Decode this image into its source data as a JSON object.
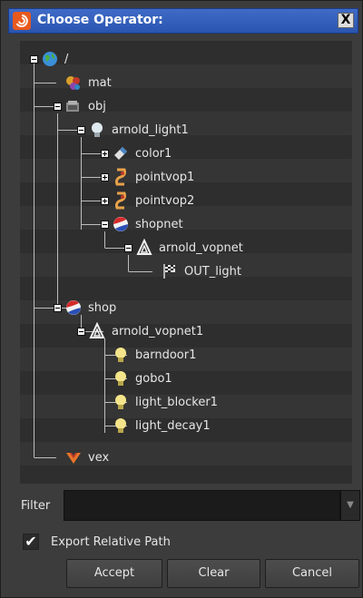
{
  "window": {
    "title": "Choose Operator:",
    "close_label": "X"
  },
  "tree": {
    "nodes": [
      {
        "label": "/",
        "icon": "globe-icon",
        "expander": "minus"
      },
      {
        "label": "mat",
        "icon": "material-network-icon",
        "expander": "none"
      },
      {
        "label": "obj",
        "icon": "object-network-icon",
        "expander": "minus"
      },
      {
        "label": "arnold_light1",
        "icon": "light-bulb-icon",
        "expander": "minus"
      },
      {
        "label": "color1",
        "icon": "color-node-icon",
        "expander": "plus"
      },
      {
        "label": "pointvop1",
        "icon": "vop-node-icon",
        "expander": "plus"
      },
      {
        "label": "pointvop2",
        "icon": "vop-node-icon",
        "expander": "plus"
      },
      {
        "label": "shopnet",
        "icon": "shop-network-icon",
        "expander": "minus"
      },
      {
        "label": "arnold_vopnet",
        "icon": "arnold-vopnet-icon",
        "expander": "minus"
      },
      {
        "label": "OUT_light",
        "icon": "output-flag-icon",
        "expander": "none"
      },
      {
        "label": "shop",
        "icon": "shop-network-icon",
        "expander": "minus"
      },
      {
        "label": "arnold_vopnet1",
        "icon": "arnold-vopnet-icon",
        "expander": "minus"
      },
      {
        "label": "barndoor1",
        "icon": "light-bulb-icon",
        "expander": "none"
      },
      {
        "label": "gobo1",
        "icon": "light-bulb-icon",
        "expander": "none"
      },
      {
        "label": "light_blocker1",
        "icon": "light-bulb-icon",
        "expander": "none"
      },
      {
        "label": "light_decay1",
        "icon": "light-bulb-icon",
        "expander": "none"
      },
      {
        "label": "vex",
        "icon": "vex-icon",
        "expander": "none"
      }
    ]
  },
  "filter": {
    "label": "Filter",
    "value": "",
    "placeholder": ""
  },
  "export_relative_path": {
    "label": "Export Relative Path",
    "checked": true
  },
  "buttons": {
    "accept": "Accept",
    "clear": "Clear",
    "cancel": "Cancel"
  },
  "colors": {
    "titlebar": "#2a55b0",
    "panel": "#3c3c3c",
    "tree_bg": "#2e2e2e",
    "text": "#e6e6e6",
    "houdini_logo": "#e8591e"
  }
}
